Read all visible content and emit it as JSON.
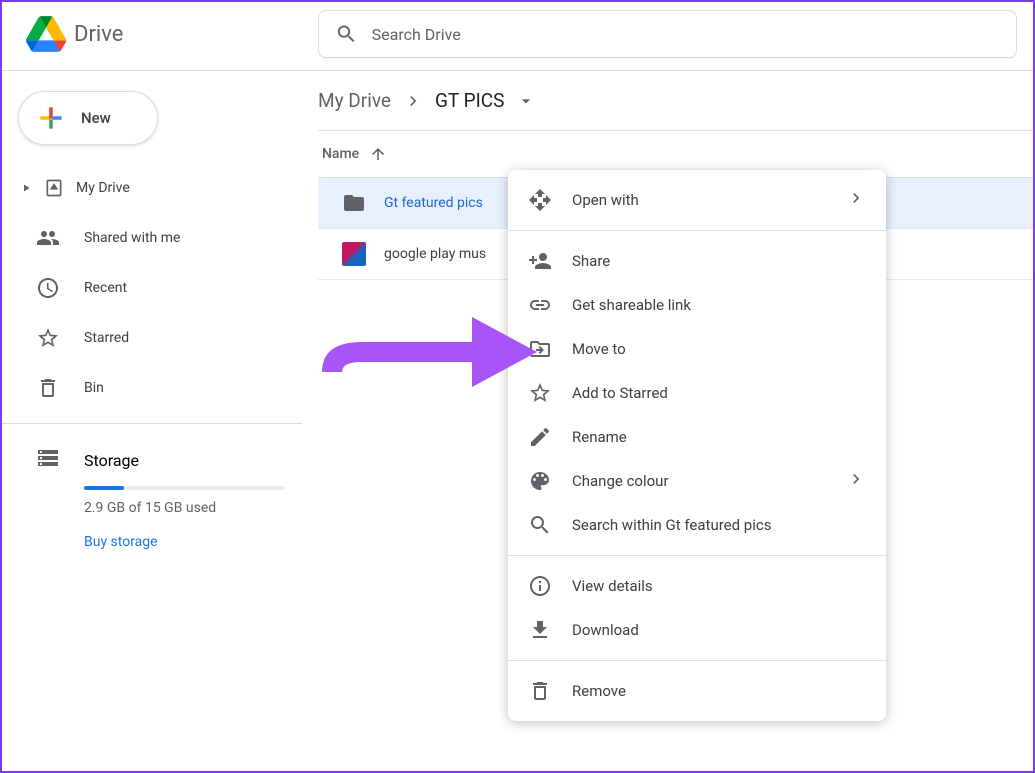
{
  "app": {
    "title": "Drive"
  },
  "search": {
    "placeholder": "Search Drive"
  },
  "new_button": {
    "label": "New"
  },
  "sidebar": {
    "items": [
      {
        "label": "My Drive",
        "icon": "drive-icon"
      },
      {
        "label": "Shared with me",
        "icon": "shared-icon"
      },
      {
        "label": "Recent",
        "icon": "recent-icon"
      },
      {
        "label": "Starred",
        "icon": "star-icon"
      },
      {
        "label": "Bin",
        "icon": "bin-icon"
      }
    ],
    "storage_label": "Storage",
    "storage_used": "2.9 GB of 15 GB used",
    "storage_percent": 19,
    "buy_link": "Buy storage"
  },
  "breadcrumb": {
    "root": "My Drive",
    "current": "GT PICS"
  },
  "columns": {
    "name": "Name"
  },
  "rows": [
    {
      "name": "Gt featured pics",
      "type": "folder",
      "selected": true
    },
    {
      "name": "google play mus",
      "type": "image",
      "selected": false
    }
  ],
  "context_menu": {
    "items_primary": [
      {
        "label": "Open with",
        "icon": "open-with-icon",
        "has_submenu": true
      }
    ],
    "items_main": [
      {
        "label": "Share",
        "icon": "person-add-icon"
      },
      {
        "label": "Get shareable link",
        "icon": "link-icon"
      },
      {
        "label": "Move to",
        "icon": "move-icon"
      },
      {
        "label": "Add to Starred",
        "icon": "star-icon"
      },
      {
        "label": "Rename",
        "icon": "rename-icon"
      },
      {
        "label": "Change colour",
        "icon": "palette-icon",
        "has_submenu": true
      },
      {
        "label": "Search within Gt featured pics",
        "icon": "search-icon"
      }
    ],
    "items_secondary": [
      {
        "label": "View details",
        "icon": "info-icon"
      },
      {
        "label": "Download",
        "icon": "download-icon"
      }
    ],
    "items_tertiary": [
      {
        "label": "Remove",
        "icon": "trash-icon"
      }
    ]
  },
  "annotation": {
    "color": "#a855f7"
  }
}
